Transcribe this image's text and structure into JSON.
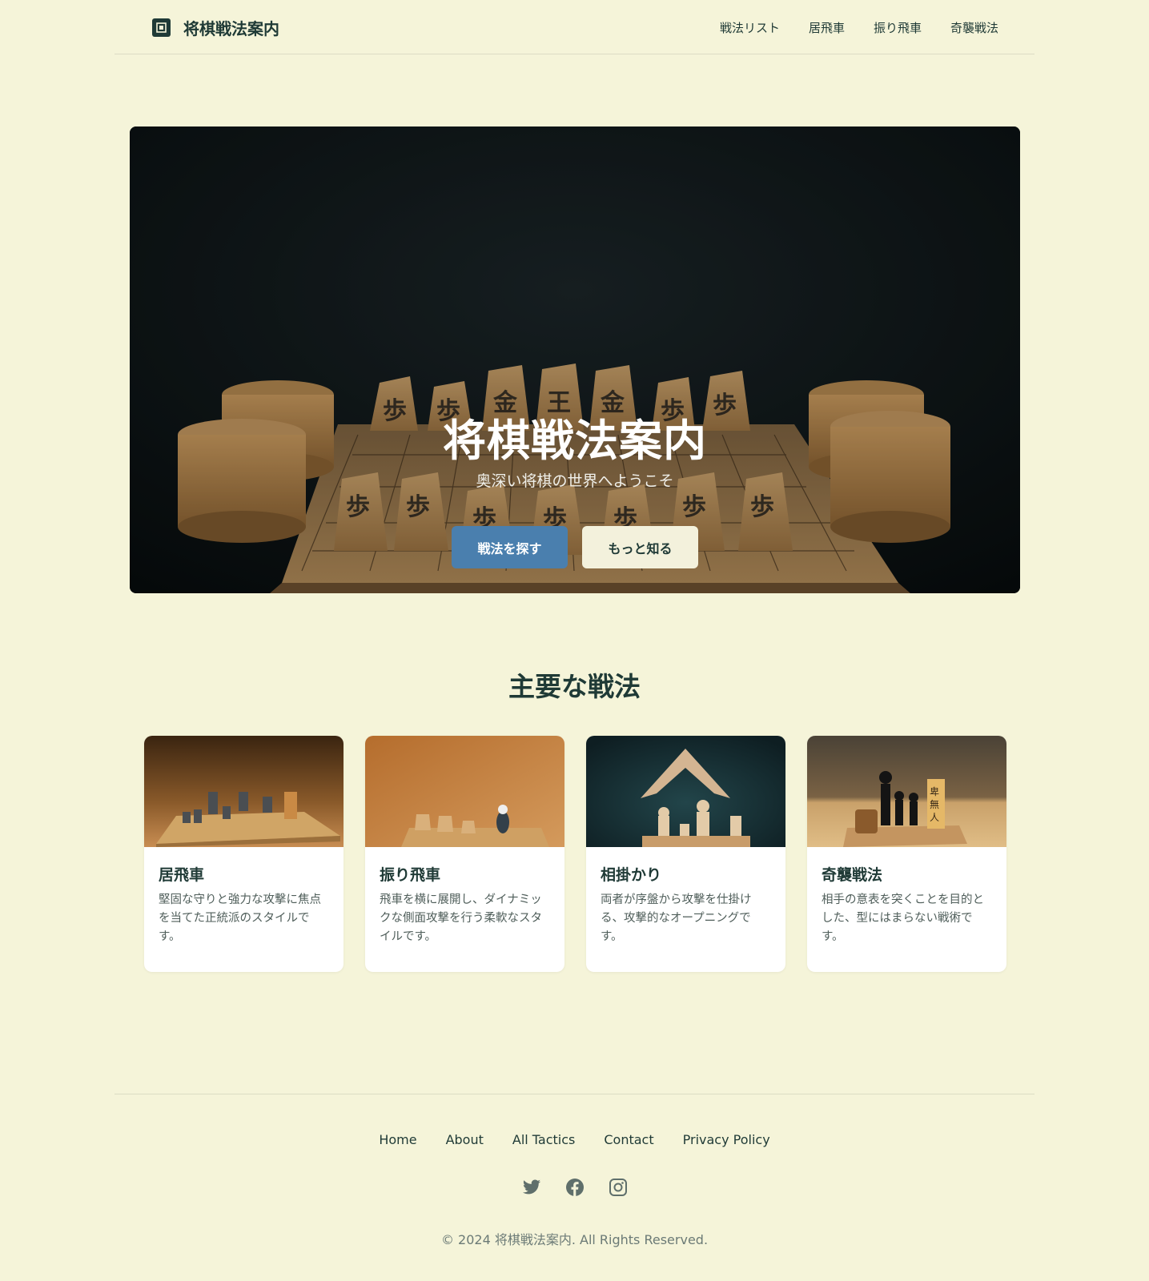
{
  "header": {
    "logo_text": "将棋戦法案内",
    "nav": [
      "戦法リスト",
      "居飛車",
      "振り飛車",
      "奇襲戦法"
    ]
  },
  "hero": {
    "title": "将棋戦法案内",
    "subtitle": "奥深い将棋の世界へようこそ",
    "primary_button": "戦法を探す",
    "secondary_button": "もっと知る"
  },
  "section": {
    "title": "主要な戦法",
    "cards": [
      {
        "title": "居飛車",
        "text": "堅固な守りと強力な攻撃に焦点を当てた正統派のスタイルです。"
      },
      {
        "title": "振り飛車",
        "text": "飛車を横に展開し、ダイナミックな側面攻撃を行う柔軟なスタイルです。"
      },
      {
        "title": "相掛かり",
        "text": "両者が序盤から攻撃を仕掛ける、攻撃的なオープニングです。"
      },
      {
        "title": "奇襲戦法",
        "text": "相手の意表を突くことを目的とした、型にはまらない戦術です。"
      }
    ]
  },
  "footer": {
    "links": [
      "Home",
      "About",
      "All Tactics",
      "Contact",
      "Privacy Policy"
    ],
    "socials": [
      "twitter-icon",
      "facebook-icon",
      "instagram-icon"
    ],
    "copyright": "© 2024 将棋戦法案内. All Rights Reserved."
  },
  "colors": {
    "background": "#f5f4d9",
    "text": "#1f3a36",
    "primary": "#4a7fae",
    "card": "#ffffff"
  }
}
